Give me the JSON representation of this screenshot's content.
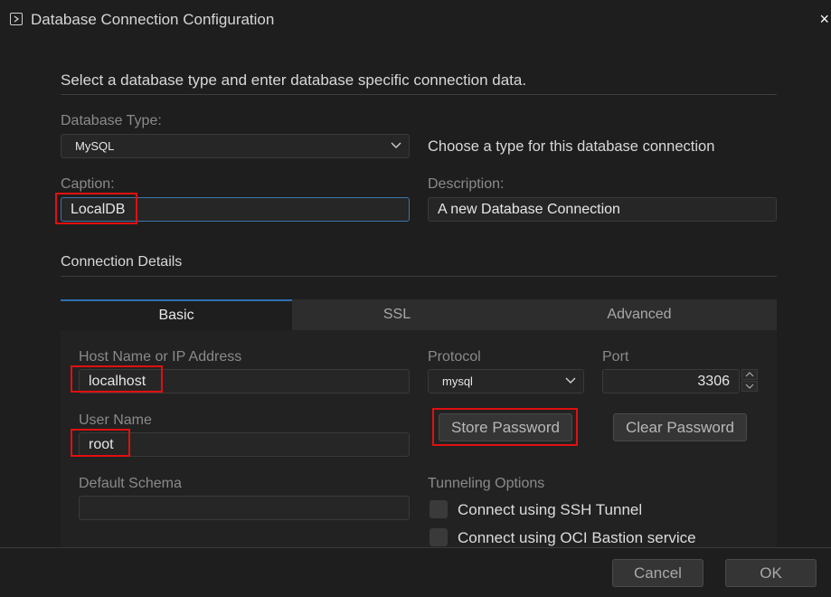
{
  "window": {
    "title": "Database Connection Configuration",
    "close_glyph": "×"
  },
  "intro": "Select a database type and enter database specific connection data.",
  "database_type": {
    "label": "Database Type:",
    "value": "MySQL",
    "hint": "Choose a type for this database connection"
  },
  "caption": {
    "label": "Caption:",
    "value": "LocalDB"
  },
  "description": {
    "label": "Description:",
    "value": "A new Database Connection"
  },
  "connection_details": "Connection Details",
  "tabs": [
    {
      "label": "Basic",
      "active": true
    },
    {
      "label": "SSL",
      "active": false
    },
    {
      "label": "Advanced",
      "active": false
    }
  ],
  "basic": {
    "host": {
      "label": "Host Name or IP Address",
      "value": "localhost"
    },
    "protocol": {
      "label": "Protocol",
      "value": "mysql"
    },
    "port": {
      "label": "Port",
      "value": "3306"
    },
    "user": {
      "label": "User Name",
      "value": "root"
    },
    "store_password": "Store Password",
    "clear_password": "Clear Password",
    "schema": {
      "label": "Default Schema",
      "value": ""
    },
    "tunneling": {
      "label": "Tunneling Options",
      "ssh": "Connect using SSH Tunnel",
      "oci": "Connect using OCI Bastion service"
    }
  },
  "footer": {
    "cancel": "Cancel",
    "ok": "OK"
  },
  "colors": {
    "accent": "#2f6fb0",
    "highlight": "#e01010",
    "background": "#1e1e1e"
  }
}
